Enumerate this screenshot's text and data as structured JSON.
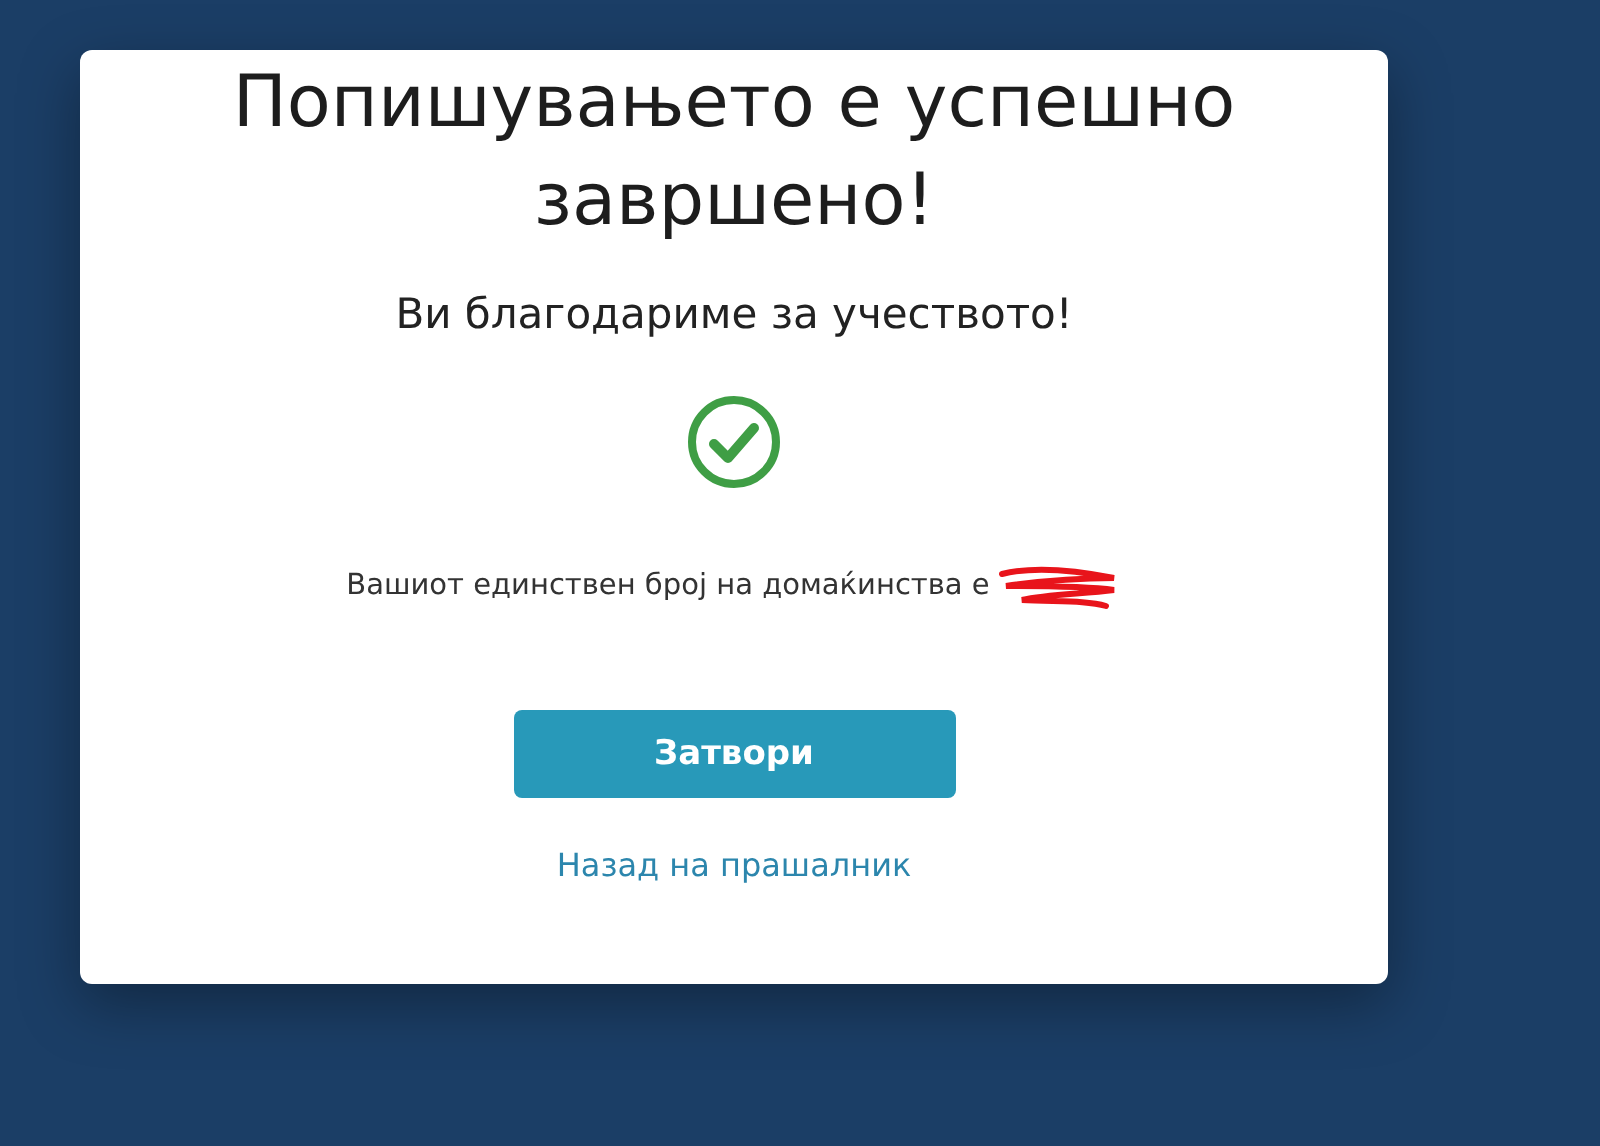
{
  "dialog": {
    "title": "Попишувањето е успешно завршено!",
    "subtitle": "Ви благодариме за учеството!",
    "message": "Вашиот единствен број на домаќинства е",
    "buttons": [
      {
        "label": "Затвори",
        "kind": "primary"
      },
      {
        "label": "Назад на прашалник",
        "kind": "link"
      }
    ]
  }
}
